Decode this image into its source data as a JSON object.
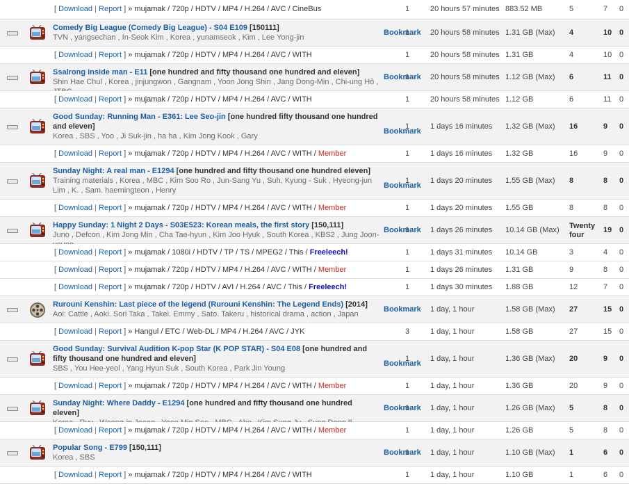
{
  "labels": {
    "download": "Download",
    "report": "Report",
    "bookmark": "Bookmark",
    "open": "[",
    "close": "]",
    "sep": " | "
  },
  "colors": {
    "link": "#1a5fa8",
    "member": "#cc2222",
    "freeleech": "#1010c0",
    "group_bg": "#f2f2f2",
    "border": "#dcdcdc"
  },
  "rows": [
    {
      "type": "torrent",
      "h": 28,
      "tail": " » mujamak / 720p / HDTV / MP4 / H.264 / AVC / CineBus",
      "files": "1",
      "time": "20 hours 57 minutes",
      "size": "883.52 MB",
      "snatches": "5",
      "seeders": "7",
      "leechers": "0"
    },
    {
      "type": "group",
      "h": 39,
      "icon": "tv-icon",
      "title": "Comedy Big League (Comedy Big League) - S04 E109",
      "title_extra": " [150111]",
      "tags": "TVN , yangsechan , In-Seok Kim , Korea , yunamseok , Kim , Lee Yong-jin",
      "files": "1",
      "time": "20 hours 58 minutes",
      "size": "1.31 GB (Max)",
      "snatches": "4",
      "seeders": "10",
      "leechers": "0"
    },
    {
      "type": "torrent",
      "h": 25,
      "tail": " » mujamak / 720p / HDTV / MP4 / H.264 / AVC / WITH",
      "files": "1",
      "time": "20 hours 58 minutes",
      "size": "1.31 GB",
      "snatches": "4",
      "seeders": "10",
      "leechers": "0"
    },
    {
      "type": "group",
      "h": 39,
      "icon": "tv-icon",
      "title": "Ssalrong inside man - E11",
      "title_extra": " [one hundred and fifty thousand one hundred and eleven]",
      "tags": "Shin Hae Chul , Korea , jinjungwon , Gangnam , Yoon Jong Shin , Jang Dong-Min , Chi-ung Hŏ , JTBC",
      "files": "1",
      "time": "20 hours 58 minutes",
      "size": "1.12 GB (Max)",
      "snatches": "6",
      "seeders": "11",
      "leechers": "0"
    },
    {
      "type": "torrent",
      "h": 25,
      "tail": " » mujamak / 720p / HDTV / MP4 / H.264 / AVC / WITH",
      "files": "1",
      "time": "20 hours 58 minutes",
      "size": "1.12 GB",
      "snatches": "6",
      "seeders": "11",
      "leechers": "0"
    },
    {
      "type": "group",
      "h": 53,
      "icon": "tv-icon",
      "title": "Good Sunday: Running Man - E361: Lee Seo-jin",
      "title_extra": " [one hundred fifty thousand one hundred and eleven]",
      "tags": "Korea , SBS , Yoo , Ji Suk-jin , ha ha , Kim Jong Kook , Gary",
      "files": "1",
      "time": "1 days 16 minutes",
      "size": "1.32 GB (Max)",
      "snatches": "16",
      "seeders": "9",
      "leechers": "0"
    },
    {
      "type": "torrent",
      "h": 25,
      "tail": " » mujamak / 720p / HDTV / MP4 / H.264 / AVC / WITH / ",
      "member": "Member",
      "files": "1",
      "time": "1 days 16 minutes",
      "size": "1.32 GB",
      "snatches": "16",
      "seeders": "9",
      "leechers": "0"
    },
    {
      "type": "group",
      "h": 53,
      "icon": "tv-icon",
      "title": "Sunday Night: A real man - E1294",
      "title_extra": " [one hundred and fifty thousand one hundred eleven]",
      "tags": "Training materials , Korea , MBC , Kim Soo Ro , Jun-Sang Yu , Suh, Kyung - Suk , Hyeong-jun Lim , K. , Sam. haemingteon , Henry",
      "files": "1",
      "time": "1 days 20 minutes",
      "size": "1.55 GB (Max)",
      "snatches": "8",
      "seeders": "8",
      "leechers": "0"
    },
    {
      "type": "torrent",
      "h": 25,
      "tail": " » mujamak / 720p / HDTV / MP4 / H.264 / AVC / WITH / ",
      "member": "Member",
      "files": "1",
      "time": "1 days 20 minutes",
      "size": "1.55 GB",
      "snatches": "8",
      "seeders": "8",
      "leechers": "0"
    },
    {
      "type": "group",
      "h": 39,
      "icon": "tv-icon",
      "title": "Happy Sunday: 1 Night 2 Days - S03E523: Korean meals, the first story",
      "title_extra": " [150,111]",
      "tags": "Juno , Defcon , Kim Jong Min , Cha Tae-hyun , Kim Joo Hyuk , South Korea , KBS2 , Jung Joon-young",
      "files": "1",
      "time": "1 days 26 minutes",
      "size": "10.14 GB (Max)",
      "snatches": "Twenty four",
      "seeders": "19",
      "leechers": "0"
    },
    {
      "type": "torrent",
      "h": 25,
      "tail": " » mujamak / 1080i / HDTV / TP / TS / MPEG2 / This / ",
      "free": "Freeleech!",
      "files": "1",
      "time": "1 days 31 minutes",
      "size": "10.14 GB",
      "snatches": "3",
      "seeders": "4",
      "leechers": "0"
    },
    {
      "type": "torrent",
      "h": 25,
      "tail": " » mujamak / 720p / HDTV / MP4 / H.264 / AVC / WITH / ",
      "member": "Member",
      "files": "1",
      "time": "1 days 26 minutes",
      "size": "1.31 GB",
      "snatches": "9",
      "seeders": "8",
      "leechers": "0"
    },
    {
      "type": "torrent",
      "h": 25,
      "tail": " » mujamak / 720p / HDTV / AVI / H.264 / AVC / This / ",
      "free": "Freeleech!",
      "files": "1",
      "time": "1 days 30 minutes",
      "size": "1.88 GB",
      "snatches": "12",
      "seeders": "7",
      "leechers": "0"
    },
    {
      "type": "group",
      "h": 39,
      "icon": "film-reel-icon",
      "title": "Rurouni Kenshin: Last piece of the legend (Rurouni Kenshin: The Legend Ends)",
      "title_extra": " [2014]",
      "tags": "Aoi: Cattle , Aoki. Sori Taka , Takei. Emmy , Sato. Takeru , historical drama , action , Japan",
      "files": "",
      "time": "1 day, 1 hour",
      "size": "1.58 GB (Max)",
      "snatches": "27",
      "seeders": "15",
      "leechers": "0"
    },
    {
      "type": "torrent",
      "h": 25,
      "tail": " » Hangul / ETC / Web-DL / MP4 / H.264 / AVC / JYK",
      "files": "3",
      "time": "1 day, 1 hour",
      "size": "1.58 GB",
      "snatches": "27",
      "seeders": "15",
      "leechers": "0"
    },
    {
      "type": "group",
      "h": 53,
      "icon": "tv-icon",
      "title": "Good Sunday: Survival Audition K-pop Star (K POP STAR) - S04 E08",
      "title_extra": " [one hundred and fifty thousand one hundred and eleven]",
      "tags": "SBS , You Hee-yeol , Yang Hyun Suk , South Korea , Park Jin Young",
      "files": "1",
      "time": "1 day, 1 hour",
      "size": "1.36 GB (Max)",
      "snatches": "20",
      "seeders": "9",
      "leechers": "0"
    },
    {
      "type": "torrent",
      "h": 25,
      "tail": " » mujamak / 720p / HDTV / MP4 / H.264 / AVC / WITH / ",
      "member": "Member",
      "files": "1",
      "time": "1 day, 1 hour",
      "size": "1.36 GB",
      "snatches": "20",
      "seeders": "9",
      "leechers": "0"
    },
    {
      "type": "group",
      "h": 39,
      "icon": "tv-icon",
      "title": "Sunday Night: Where Daddy - E1294",
      "title_extra": " [one hundred and fifty thousand one hundred eleven]",
      "tags": "Korea , Ryu , Woong-in Jeong , Yoon Min Soo , MBC , Ahn , Kim Sung Ju , Sung Dong Il",
      "files": "1",
      "time": "1 day, 1 hour",
      "size": "1.26 GB (Max)",
      "snatches": "5",
      "seeders": "8",
      "leechers": "0"
    },
    {
      "type": "torrent",
      "h": 25,
      "tail": " » mujamak / 720p / HDTV / MP4 / H.264 / AVC / WITH / ",
      "member": "Member",
      "files": "1",
      "time": "1 day, 1 hour",
      "size": "1.26 GB",
      "snatches": "5",
      "seeders": "8",
      "leechers": "0"
    },
    {
      "type": "group",
      "h": 39,
      "icon": "tv-icon",
      "title": "Popular Song - E799",
      "title_extra": " [150,111]",
      "tags": "Korea , SBS",
      "files": "1",
      "time": "1 day, 1 hour",
      "size": "1.10 GB (Max)",
      "snatches": "1",
      "seeders": "6",
      "leechers": "0"
    },
    {
      "type": "torrent",
      "h": 25,
      "tail": " » mujamak / 720p / HDTV / MP4 / H.264 / AVC / WITH",
      "files": "1",
      "time": "1 day, 1 hour",
      "size": "1.10 GB",
      "snatches": "1",
      "seeders": "6",
      "leechers": "0"
    }
  ]
}
